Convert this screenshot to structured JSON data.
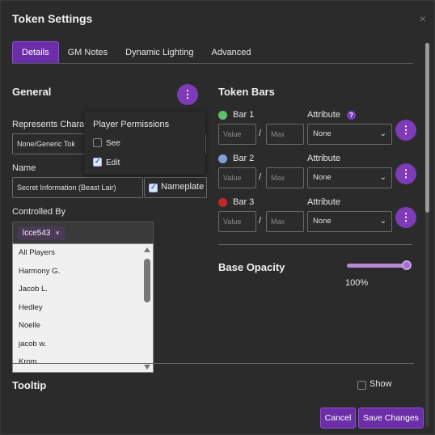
{
  "dialog": {
    "title": "Token Settings",
    "close": "×"
  },
  "tabs": [
    {
      "label": "Details",
      "active": true
    },
    {
      "label": "GM Notes"
    },
    {
      "label": "Dynamic Lighting"
    },
    {
      "label": "Advanced"
    }
  ],
  "general": {
    "heading": "General",
    "more": "⋮",
    "represents_label": "Represents Chara",
    "represents_value": "None/Generic Tok",
    "name_label": "Name",
    "name_value": "Secret Information (Beast Lair)",
    "nameplate_label": "Nameplate",
    "nameplate_checked": true,
    "controlled_label": "Controlled By",
    "controlled_chip": "lcce543",
    "chip_remove": "×"
  },
  "permissions": {
    "title": "Player Permissions",
    "see_label": "See",
    "see_checked": false,
    "edit_label": "Edit",
    "edit_checked": true
  },
  "players_list": [
    "All Players",
    "Harmony G.",
    "Jacob L.",
    "Hedley",
    "Noelle",
    "jacob w.",
    "Krom"
  ],
  "token_bars": {
    "heading": "Token Bars",
    "bars": [
      {
        "label": "Bar 1",
        "color": "#5fbf6a",
        "value_ph": "Value",
        "max_ph": "Max",
        "sep": "/",
        "attr_label": "Attribute",
        "attr_value": "None",
        "more": "⋮"
      },
      {
        "label": "Bar 2",
        "color": "#7f9fd6",
        "value_ph": "Value",
        "max_ph": "Max",
        "sep": "/",
        "attr_label": "Attribute",
        "attr_value": "None",
        "more": "⋮"
      },
      {
        "label": "Bar 3",
        "color": "#c0282a",
        "value_ph": "Value",
        "max_ph": "Max",
        "sep": "/",
        "attr_label": "Attribute",
        "attr_value": "None",
        "more": "⋮"
      }
    ],
    "help": "?"
  },
  "opacity": {
    "heading": "Base Opacity",
    "value": "100%",
    "level": 1.0
  },
  "tooltip": {
    "heading": "Tooltip",
    "show_label": "Show",
    "show_checked": false
  },
  "footer": {
    "cancel": "Cancel",
    "save": "Save Changes"
  },
  "colors": {
    "accent": "#6c2ea8",
    "background": "#2b2b2b"
  }
}
